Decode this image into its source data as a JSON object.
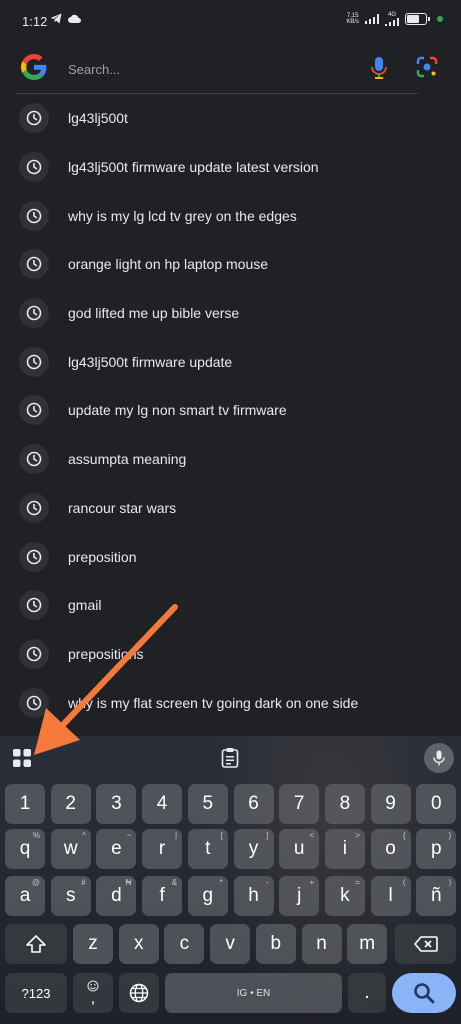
{
  "status_bar": {
    "time": "1:12",
    "net_speed_top": "7.15",
    "net_speed_unit": "KB/s",
    "network_label": "4G"
  },
  "search": {
    "placeholder": "Search..."
  },
  "suggestions": [
    "lg43lj500t",
    "lg43lj500t firmware update latest version",
    "why is my lg lcd tv grey on the edges",
    "orange light on hp laptop mouse",
    "god lifted me up bible verse",
    "lg43lj500t firmware update",
    "update my lg non smart tv firmware",
    "assumpta meaning",
    "rancour star wars",
    "preposition",
    "gmail",
    "prepositions",
    "why is my flat screen tv going dark on one side"
  ],
  "keyboard": {
    "numbers": [
      "1",
      "2",
      "3",
      "4",
      "5",
      "6",
      "7",
      "8",
      "9",
      "0"
    ],
    "row1": [
      "q",
      "w",
      "e",
      "r",
      "t",
      "y",
      "u",
      "i",
      "o",
      "p"
    ],
    "row1_hints": [
      "%",
      "^",
      "~",
      "|",
      "[",
      "]",
      "<",
      ">",
      "{",
      "}"
    ],
    "row2": [
      "a",
      "s",
      "d",
      "f",
      "g",
      "h",
      "j",
      "k",
      "l",
      "ñ"
    ],
    "row2_hints": [
      "@",
      "#",
      "₦",
      "&",
      "*",
      "-",
      "+",
      "=",
      "(",
      ")"
    ],
    "row3": [
      "z",
      "x",
      "c",
      "v",
      "b",
      "n",
      "m"
    ],
    "row3_hints": [
      "",
      "",
      "",
      "",
      "",
      "",
      ""
    ],
    "symbols_label": "?123",
    "emoji_label": ",",
    "space_label": "IG • EN",
    "period_label": "."
  },
  "colors": {
    "background": "#202124",
    "search_key": "#8ab4f8",
    "annotation_arrow": "#f4793a"
  }
}
